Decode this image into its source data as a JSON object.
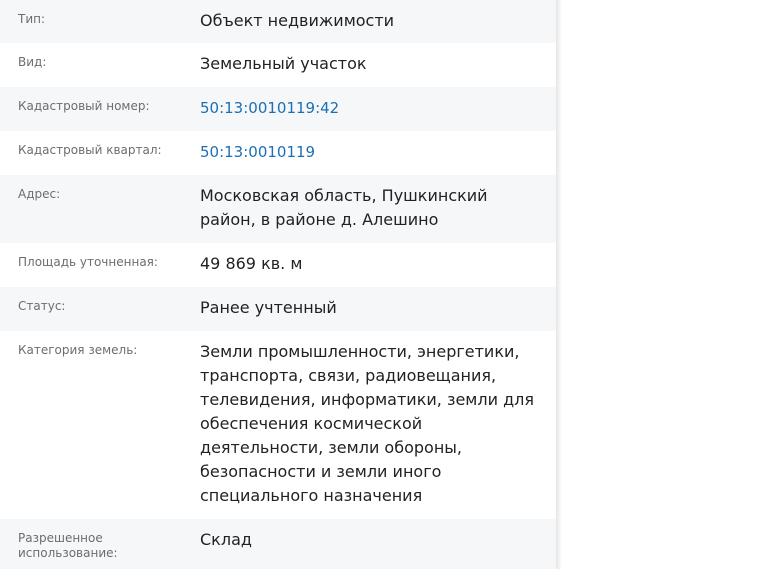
{
  "rows": [
    {
      "label": "Тип:",
      "value": "Объект недвижимости"
    },
    {
      "label": "Вид:",
      "value": "Земельный участок"
    },
    {
      "label": "Кадастровый номер:",
      "value": "50:13:0010119:42"
    },
    {
      "label": "Кадастровый квартал:",
      "value": "50:13:0010119"
    },
    {
      "label": "Адрес:",
      "value": "Московская область, Пушкинский район, в районе д. Алешино"
    },
    {
      "label": "Площадь уточненная:",
      "value": "49 869 кв. м"
    },
    {
      "label": "Статус:",
      "value": "Ранее учтенный"
    },
    {
      "label": "Категория земель:",
      "value": "Земли промышленности, энергетики, транспорта, связи, радиовещания, телевидения, информатики, земли для обеспечения космической деятельности, земли обороны, безопасности и земли иного специального назначения"
    },
    {
      "label": "Разрешенное использование:",
      "value": "Склад"
    }
  ],
  "colors": {
    "label": "#6d6d6d",
    "value": "#222222",
    "link": "#1a6fb5",
    "stripe": "#f6f7f8"
  }
}
